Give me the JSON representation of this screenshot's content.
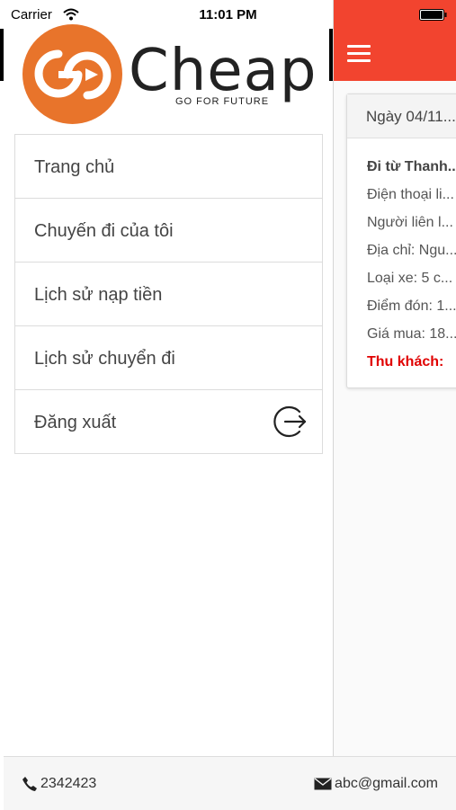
{
  "status_bar": {
    "carrier": "Carrier",
    "time": "11:01 PM"
  },
  "brand": {
    "logo_mark": "GO",
    "name": "Cheap",
    "tagline": "GO FOR FUTURE",
    "accent_color": "#e8742b",
    "header_color": "#f2442f"
  },
  "menu": {
    "items": [
      {
        "label": "Trang chủ"
      },
      {
        "label": "Chuyến đi của tôi"
      },
      {
        "label": "Lịch sử nạp tiền"
      },
      {
        "label": "Lịch sử chuyển đi"
      },
      {
        "label": "Đăng xuất",
        "icon": "logout-icon"
      }
    ]
  },
  "trip_card": {
    "header": "Ngày 04/11...",
    "title": "Đi từ Thanh...",
    "lines": [
      "Điện thoại li...",
      "Người liên l...",
      "Địa chỉ: Ngu...",
      "Loại xe: 5 c...",
      "Điểm đón: 1...",
      "Giá mua: 18..."
    ],
    "pay_label": "Thu khách:"
  },
  "footer": {
    "phone": "2342423",
    "phone_icon": "phone-icon",
    "email": "abc@gmail.com",
    "email_icon": "envelope-icon"
  }
}
